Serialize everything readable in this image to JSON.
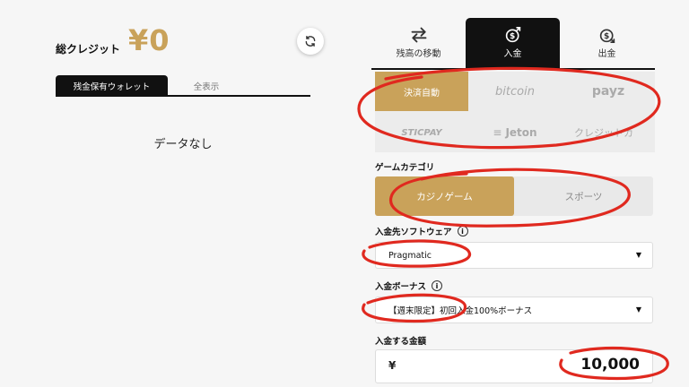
{
  "left": {
    "total_label": "総クレジット",
    "total_value": "¥0",
    "wallet_tabs": {
      "active": "残金保有ウォレット",
      "inactive": "全表示"
    },
    "empty_text": "データなし"
  },
  "tabs": [
    {
      "label": "残高の移動",
      "icon": "transfer-arrows-icon"
    },
    {
      "label": "入金",
      "icon": "dollar-in-icon"
    },
    {
      "label": "出金",
      "icon": "dollar-out-icon"
    }
  ],
  "methods": [
    "決済自動",
    "bitcoin",
    "payz",
    "STICPAY",
    "Jeton",
    "クレジットカ"
  ],
  "game_category": {
    "label": "ゲームカテゴリ",
    "options": [
      "カジノゲーム",
      "スポーツ"
    ]
  },
  "software": {
    "label": "入金先ソフトウェア",
    "value": "Pragmatic"
  },
  "bonus": {
    "label": "入金ボーナス",
    "value": "【週末限定】初回入金100%ボーナス"
  },
  "amount": {
    "label": "入金する金額",
    "currency": "¥",
    "value": "10,000"
  },
  "colors": {
    "accent": "#c9a25a",
    "dark": "#111111",
    "annotation": "#e0291f"
  }
}
